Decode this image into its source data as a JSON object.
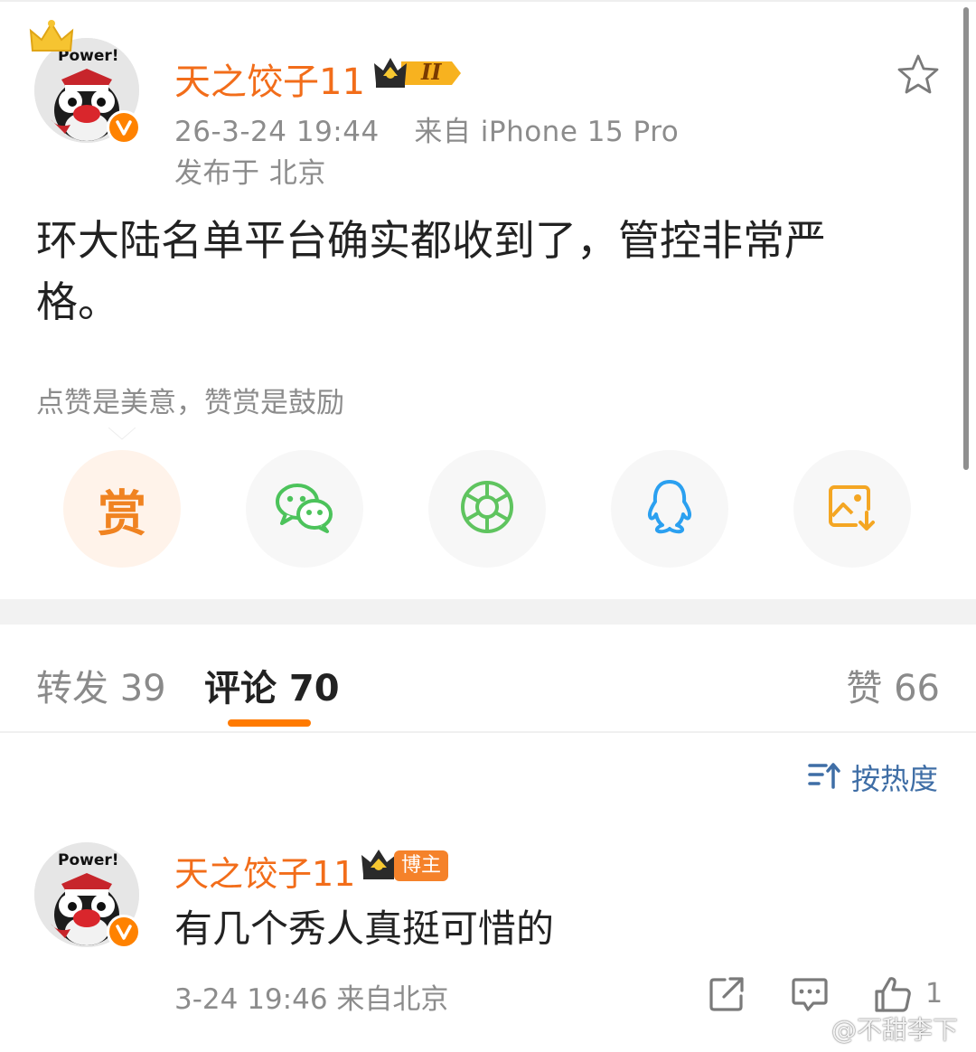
{
  "post": {
    "author": {
      "name": "天之饺子11",
      "avatar_caption": "Power!",
      "verified": true,
      "level_badge": "II"
    },
    "timestamp": "26-3-24 19:44",
    "source": "来自 iPhone 15 Pro",
    "location": "发布于 北京",
    "body": "环大陆名单平台确实都收到了，管控非常严格。",
    "reward_tip": "点赞是美意，赞赏是鼓励",
    "share_targets": [
      {
        "name": "reward",
        "glyph": "赏"
      },
      {
        "name": "wechat-icon"
      },
      {
        "name": "moments-icon"
      },
      {
        "name": "qq-icon"
      },
      {
        "name": "save-image-icon"
      }
    ]
  },
  "tabs": {
    "repost": "转发 39",
    "comments": "评论 70",
    "likes": "赞 66",
    "active": "comments"
  },
  "sort": {
    "label": "按热度"
  },
  "comment": {
    "author": "天之饺子11",
    "avatar_caption": "Power!",
    "badge_label": "博主",
    "text": "有几个秀人真挺可惜的",
    "meta": "3-24 19:46  来自北京",
    "like_count": "1"
  },
  "watermark": "@不甜李下",
  "colors": {
    "accent_orange": "#ff7a00",
    "author_orange": "#f26d1a",
    "sort_blue": "#3f6ea6",
    "wechat_green": "#4cc35b",
    "qq_blue": "#2ba0f0",
    "save_yellow": "#f4a623"
  }
}
